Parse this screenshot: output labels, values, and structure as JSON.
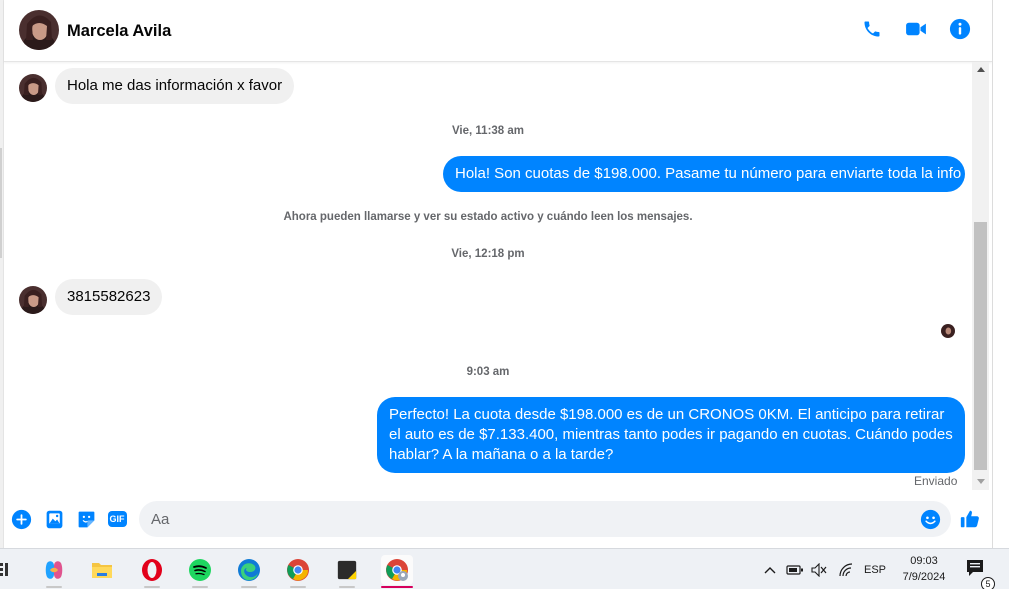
{
  "contact": {
    "name": "Marcela Avila"
  },
  "messages": [
    {
      "direction": "in",
      "text": "Hola me das información x favor"
    },
    {
      "type": "time",
      "text": "Vie, 11:38 am"
    },
    {
      "direction": "out",
      "text": "Hola! Son cuotas de $198.000. Pasame tu número para enviarte toda la info"
    },
    {
      "type": "system",
      "text": "Ahora pueden llamarse y ver su estado activo y cuándo leen los mensajes."
    },
    {
      "type": "time",
      "text": "Vie, 12:18 pm"
    },
    {
      "direction": "in",
      "text": "3815582623"
    },
    {
      "type": "time",
      "text": "9:03 am"
    },
    {
      "direction": "out",
      "text": "Perfecto! La cuota desde $198.000 es de un CRONOS 0KM. El anticipo para retirar el auto es de $7.133.400, mientras tanto podes ir pagando en cuotas. Cuándo podes hablar? A la mañana o a la tarde?"
    }
  ],
  "status": "Enviado",
  "composer": {
    "placeholder": "Aa",
    "gif_label": "GIF"
  },
  "header_icons": [
    "phone-icon",
    "video-icon",
    "info-icon"
  ],
  "taskbar": {
    "apps": [
      "copilot",
      "file-explorer",
      "opera",
      "spotify",
      "edge",
      "chrome",
      "sticky-notes",
      "chrome-profile"
    ],
    "language": "ESP",
    "time": "09:03",
    "date": "7/9/2024",
    "notification_count": "5"
  },
  "colors": {
    "accent": "#0084ff",
    "bubble_in": "#f0f0f0",
    "meta_text": "#65676b"
  }
}
